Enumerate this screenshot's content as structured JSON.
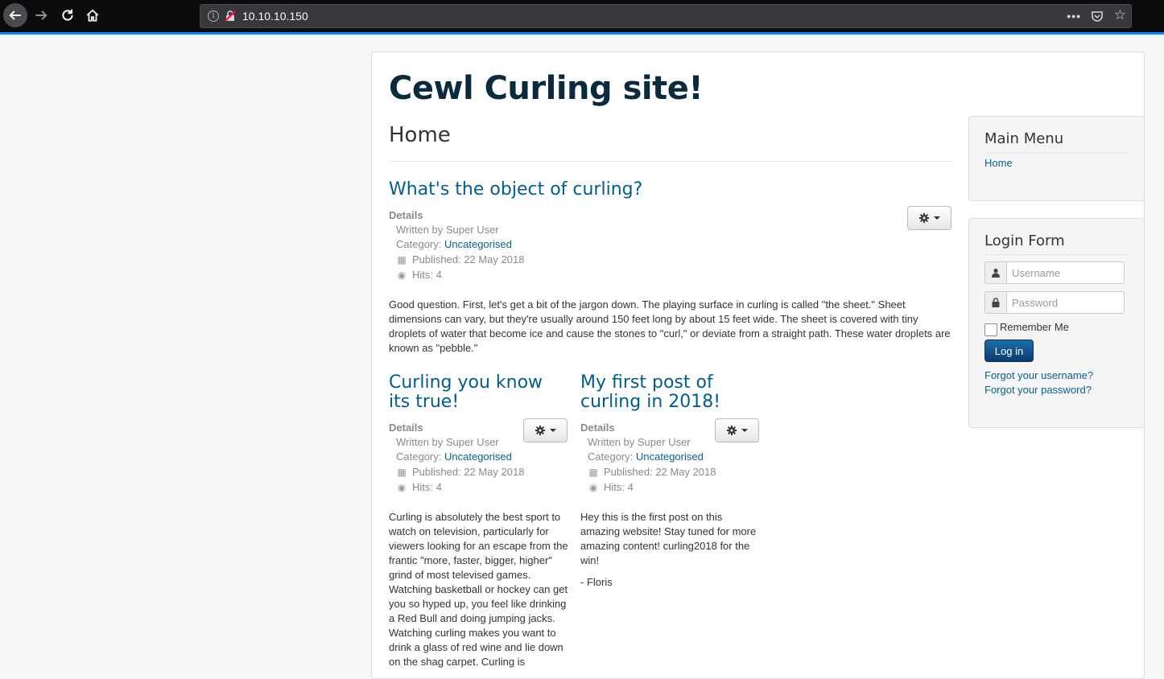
{
  "browser": {
    "url": "10.10.10.150",
    "more_glyph": "•••",
    "star_glyph": "☆",
    "info_glyph": "i"
  },
  "site": {
    "title": "Cewl Curling site!",
    "page_heading": "Home"
  },
  "articles": [
    {
      "title": "What's the object of curling?",
      "details_label": "Details",
      "written_by": "Written by Super User",
      "category_label": "Category:",
      "category": "Uncategorised",
      "published": "Published: 22 May 2018",
      "hits": "Hits: 4",
      "body": "Good question. First, let's get a bit of the jargon down. The playing surface in curling is called \"the sheet.\" Sheet dimensions can vary, but they're usually around 150 feet long by about 15 feet wide. The sheet is covered with tiny droplets of water that become ice and cause the stones to \"curl,\" or deviate from a straight path. These water droplets are known as \"pebble.\""
    },
    {
      "title": "Curling you know its true!",
      "details_label": "Details",
      "written_by": "Written by Super User",
      "category_label": "Category:",
      "category": "Uncategorised",
      "published": "Published: 22 May 2018",
      "hits": "Hits: 4",
      "body": "Curling is absolutely the best sport to watch on television, particularly for viewers looking for an escape from the frantic \"more, faster, bigger, higher\" grind of most televised games. Watching basketball or hockey can get you so hyped up, you feel like drinking a Red Bull and doing jumping jacks. Watching curling makes you want to drink a glass of red wine and lie down on the shag carpet. Curling is"
    },
    {
      "title": "My first post of curling in 2018!",
      "details_label": "Details",
      "written_by": "Written by Super User",
      "category_label": "Category:",
      "category": "Uncategorised",
      "published": "Published: 22 May 2018",
      "hits": "Hits: 4",
      "body": "Hey this is the first post on this amazing website! Stay tuned for more amazing content! curling2018 for the win!",
      "signature": "- Floris"
    }
  ],
  "sidebar": {
    "main_menu": {
      "heading": "Main Menu",
      "items": [
        "Home"
      ]
    },
    "login_form": {
      "heading": "Login Form",
      "username_placeholder": "Username",
      "password_placeholder": "Password",
      "remember_label": "Remember Me",
      "login_button": "Log in",
      "forgot_username": "Forgot your username?",
      "forgot_password": "Forgot your password?"
    }
  },
  "colors": {
    "accent_link": "#08628f",
    "title_blue": "#005e8d",
    "login_button": "#0c3a72"
  }
}
